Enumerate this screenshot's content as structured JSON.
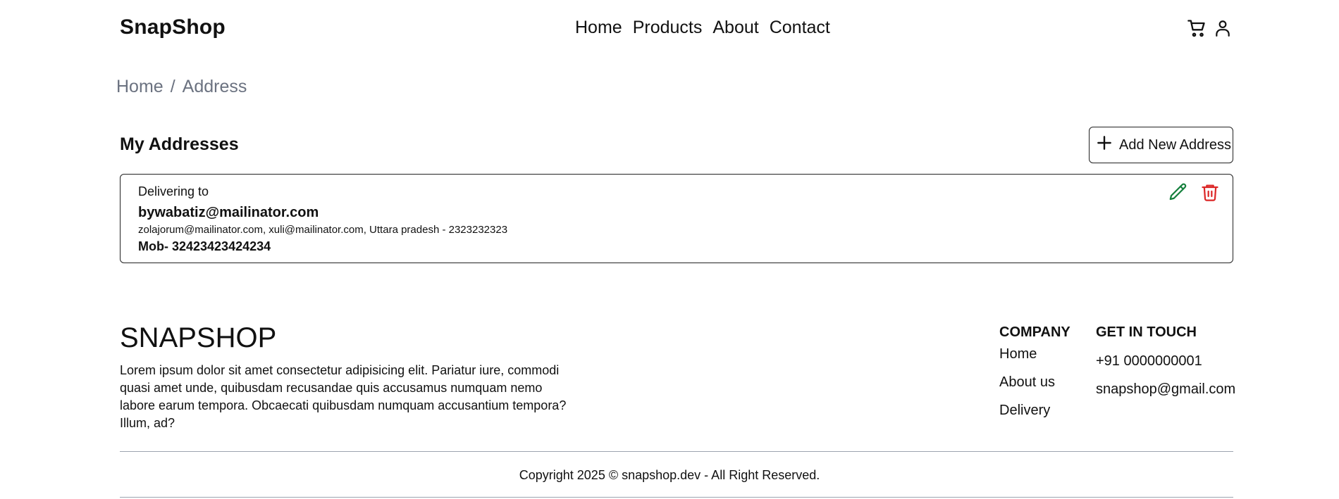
{
  "header": {
    "brand": "SnapShop",
    "nav": [
      "Home",
      "Products",
      "About",
      "Contact"
    ],
    "icons": [
      "cart-icon",
      "user-icon"
    ]
  },
  "breadcrumb": {
    "home": "Home",
    "separator": "/",
    "current": "Address"
  },
  "addresses": {
    "title": "My Addresses",
    "add_label": "Add New Address",
    "items": [
      {
        "heading": "Delivering to",
        "email": "bywabatiz@mailinator.com",
        "details": "zolajorum@mailinator.com, xuli@mailinator.com, Uttara pradesh - 2323232323",
        "mobile": "Mob- 32423423424234"
      }
    ],
    "edit_color": "#15803d",
    "delete_color": "#dc2626"
  },
  "footer": {
    "brand": "SNAPSHOP",
    "description": "Lorem ipsum dolor sit amet consectetur adipisicing elit. Pariatur iure, commodi quasi amet unde, quibusdam recusandae quis accusamus numquam nemo labore earum tempora. Obcaecati quibusdam numquam accusantium tempora? Illum, ad?",
    "company_title": "COMPANY",
    "company_links": [
      "Home",
      "About us",
      "Delivery"
    ],
    "contact_title": "GET IN TOUCH",
    "phone": "+91 0000000001",
    "email": "snapshop@gmail.com",
    "copyright": "Copyright 2025 © snapshop.dev - All Right Reserved."
  }
}
